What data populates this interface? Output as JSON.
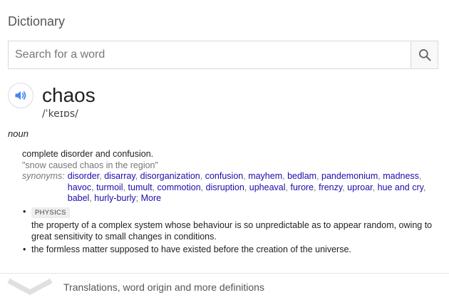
{
  "header": {
    "title": "Dictionary"
  },
  "search": {
    "placeholder": "Search for a word",
    "value": ""
  },
  "entry": {
    "word": "chaos",
    "phonetic": "/ˈkeɪɒs/",
    "part_of_speech": "noun",
    "senses": [
      {
        "definition": "complete disorder and confusion.",
        "example": "\"snow caused chaos in the region\"",
        "synonyms_label": "synonyms:",
        "synonyms": [
          "disorder",
          "disarray",
          "disorganization",
          "confusion",
          "mayhem",
          "bedlam",
          "pandemonium",
          "madness",
          "havoc",
          "turmoil",
          "tumult",
          "commotion",
          "disruption",
          "upheaval",
          "furore",
          "frenzy",
          "uproar",
          "hue and cry",
          "babel",
          "hurly-burly"
        ],
        "more_label": "More"
      },
      {
        "tag": "PHYSICS",
        "definition": "the property of a complex system whose behaviour is so unpredictable as to appear random, owing to great sensitivity to small changes in conditions."
      },
      {
        "definition": "the formless matter supposed to have existed before the creation of the universe."
      }
    ]
  },
  "footer": {
    "label": "Translations, word origin and more definitions"
  },
  "colors": {
    "link": "#1a0dab",
    "accent_blue": "#4285f4",
    "muted": "#777777"
  },
  "icons": {
    "search": "search-icon",
    "speaker": "speaker-icon",
    "expand": "chevron-down-icon"
  }
}
